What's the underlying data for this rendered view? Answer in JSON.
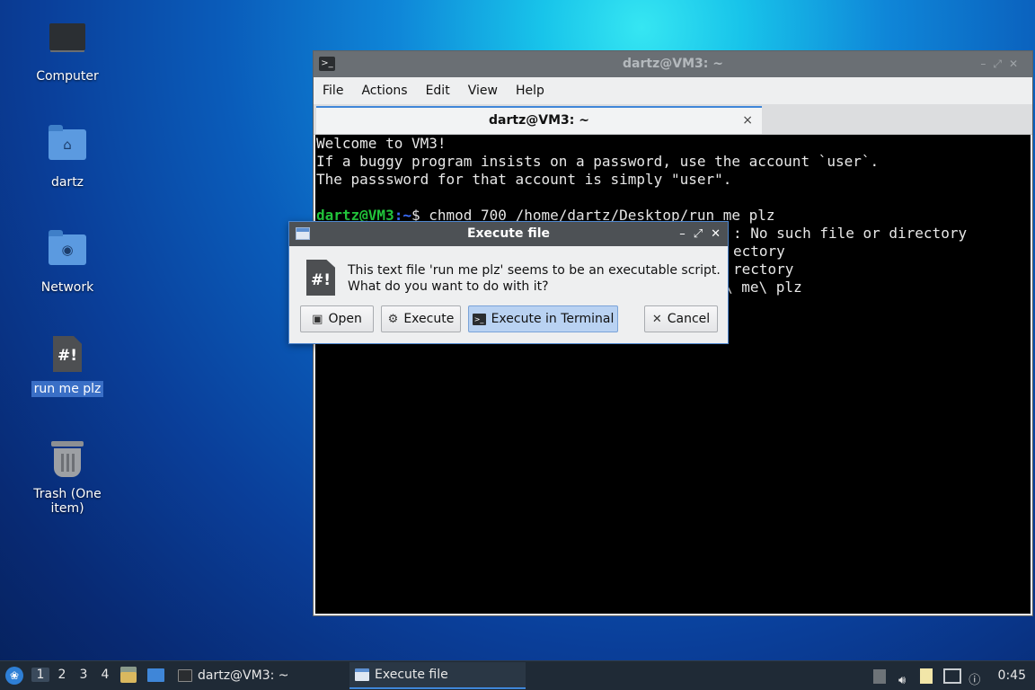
{
  "desktop": {
    "icons": [
      {
        "label": "Computer",
        "icon": "computer-icon"
      },
      {
        "label": "dartz",
        "icon": "home-folder-icon"
      },
      {
        "label": "Network",
        "icon": "network-folder-icon"
      },
      {
        "label": "run me plz",
        "icon": "script-file-icon"
      },
      {
        "label": "Trash (One item)",
        "icon": "trash-icon"
      }
    ]
  },
  "terminal": {
    "title": "dartz@VM3: ~",
    "menu": [
      "File",
      "Actions",
      "Edit",
      "View",
      "Help"
    ],
    "tab_title": "dartz@VM3: ~",
    "tab_close": "×",
    "lines": [
      "Welcome to VM3!",
      "If a buggy program insists on a password, use the account `user`.",
      "The passsword for that account is simply \"user\"."
    ],
    "prompt_user": "dartz@VM3",
    "prompt_path": ":~",
    "prompt_symbol": "$ ",
    "command": "chmod 700 /home/dartz/Desktop/run me plz",
    "output_visible": [
      ": No such file or directory",
      "ectory",
      "rectory",
      "\\ me\\ plz"
    ]
  },
  "dialog": {
    "title": "Execute file",
    "message_line1": "This text file 'run me plz' seems to be an executable script.",
    "message_line2": "What do you want to do with it?",
    "buttons": {
      "open": "Open",
      "execute": "Execute",
      "execute_terminal": "Execute in Terminal",
      "cancel": "Cancel"
    },
    "controls": {
      "minimize": "–",
      "maximize": "⤢",
      "close": "✕"
    }
  },
  "taskbar": {
    "workspaces": [
      "1",
      "2",
      "3",
      "4"
    ],
    "current_workspace": "1",
    "tasks": [
      {
        "label": "dartz@VM3: ~",
        "icon": "terminal-icon",
        "active": false
      },
      {
        "label": "Execute file",
        "icon": "window-icon",
        "active": true
      }
    ],
    "clock": "0:45"
  },
  "colors": {
    "accent": "#3f86d8",
    "prompt_user": "#22c63c",
    "prompt_path": "#3b6fff",
    "terminal_bg": "#000000"
  }
}
